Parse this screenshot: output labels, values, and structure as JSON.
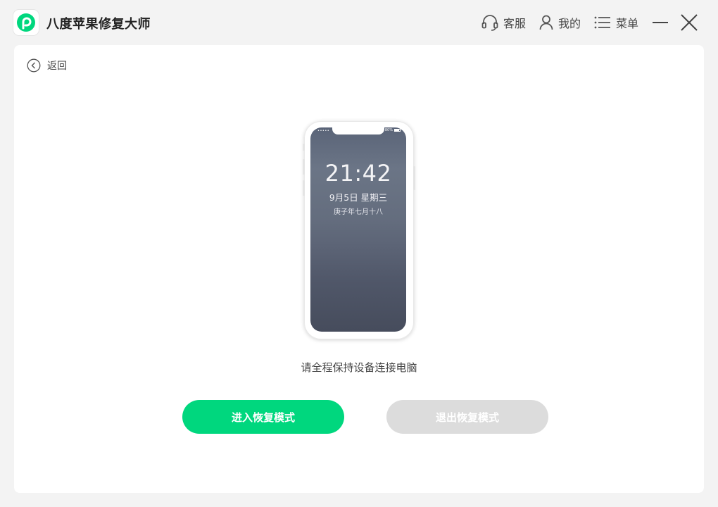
{
  "app": {
    "title": "八度苹果修复大师",
    "brand_color": "#00d77e"
  },
  "titlebar": {
    "support_label": "客服",
    "account_label": "我的",
    "menu_label": "菜单",
    "minimize_icon": "minimize-icon",
    "close_icon": "close-icon"
  },
  "nav": {
    "back_label": "返回"
  },
  "phone": {
    "time": "21:42",
    "date": "9月5日 星期三",
    "lunar_date": "庚子年七月十八",
    "status_signal": "•••••",
    "status_battery": "80%"
  },
  "main": {
    "hint": "请全程保持设备连接电脑",
    "enter_button": "进入恢复模式",
    "exit_button": "退出恢复模式",
    "exit_button_disabled": true
  }
}
